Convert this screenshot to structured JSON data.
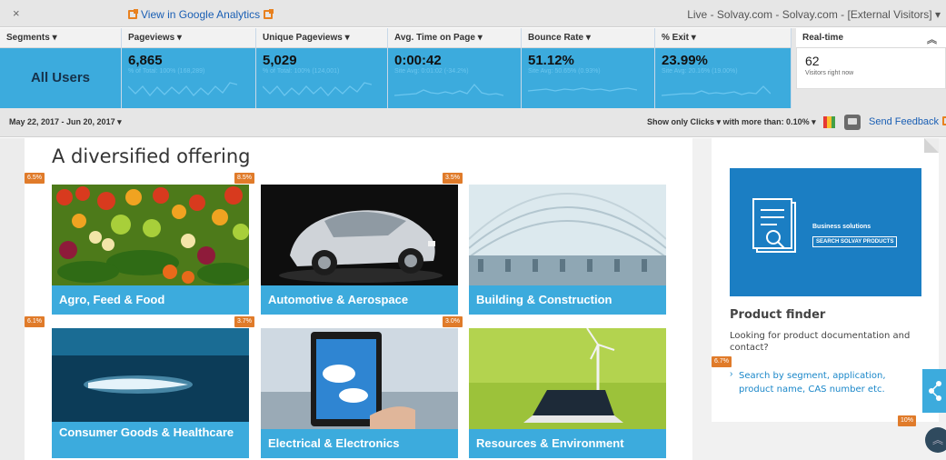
{
  "top": {
    "close": "×",
    "ga_link": "View in Google Analytics",
    "title": "Live - Solvay.com - Solvay.com - [External Visitors]"
  },
  "metrics": {
    "segments_label": "Segments",
    "segment_value": "All Users",
    "columns": [
      {
        "label": "Pageviews",
        "value": "6,865",
        "sub": "% of Total: 100% (168,289)"
      },
      {
        "label": "Unique Pageviews",
        "value": "5,029",
        "sub": "% of Total: 100% (124,001)"
      },
      {
        "label": "Avg. Time on Page",
        "value": "0:00:42",
        "sub": "Site Avg: 0:01:02 (-34.2%)"
      },
      {
        "label": "Bounce Rate",
        "value": "51.12%",
        "sub": "Site Avg: 50.65% (0.93%)"
      },
      {
        "label": "% Exit",
        "value": "23.99%",
        "sub": "Site Avg: 20.16% (19.00%)"
      }
    ],
    "realtime": {
      "label": "Real-time",
      "count": "62",
      "caption": "Visitors right now"
    }
  },
  "datebar": {
    "range": "May 22, 2017 - Jun 20, 2017",
    "show_only": "Show only  Clicks",
    "with_more": "with more than:  0.10%",
    "feedback": "Send Feedback"
  },
  "page": {
    "heading": "A diversified offering",
    "tiles": [
      {
        "label": "Agro, Feed & Food",
        "pct": "6.5%"
      },
      {
        "label": "Automotive & Aerospace",
        "pct": "8.5%"
      },
      {
        "label": "Building & Construction",
        "pct": "3.5%"
      },
      {
        "label": "Consumer Goods & Healthcare",
        "pct": "6.1%"
      },
      {
        "label": "Electrical & Electronics",
        "pct": "3.7%"
      },
      {
        "label": "Resources & Environment",
        "pct": "3.0%"
      }
    ],
    "sidebar": {
      "promo_line1": "Business solutions",
      "promo_line2": "SEARCH SOLVAY PRODUCTS",
      "title": "Product finder",
      "desc": "Looking for product documentation and contact?",
      "link": "Search by segment, application, product name, CAS number etc.",
      "pct_link": "6.7%",
      "pct_bottom": "10%"
    }
  },
  "colors": {
    "accent": "#3cabdd",
    "badge": "#e07b2a",
    "link": "#1a5fb4"
  }
}
